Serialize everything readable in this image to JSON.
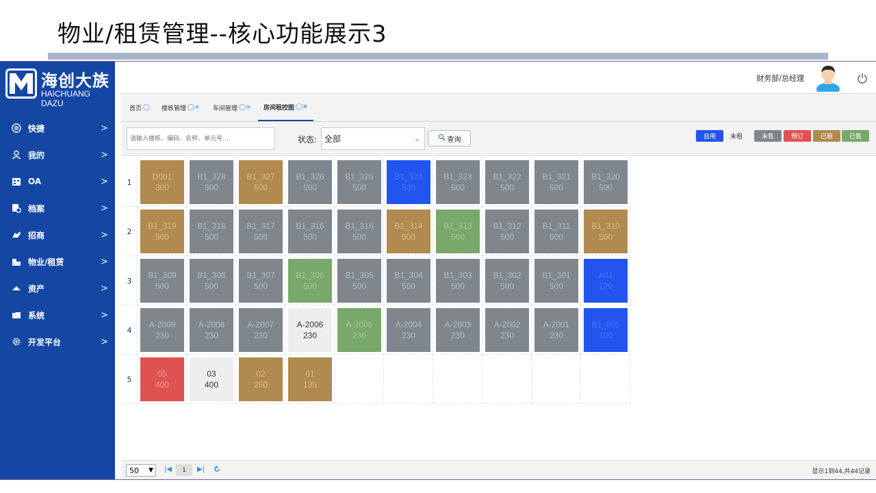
{
  "slide": {
    "title": "物业/租赁管理--核心功能展示3"
  },
  "brand": {
    "name": "海创大族",
    "subtitle": "HAICHUANG DAZU"
  },
  "sidebar": {
    "items": [
      {
        "label": "快捷",
        "icon": "list-circle-icon"
      },
      {
        "label": "我的",
        "icon": "user-icon"
      },
      {
        "label": "OA",
        "icon": "calendar-icon"
      },
      {
        "label": "档案",
        "icon": "archive-icon"
      },
      {
        "label": "招商",
        "icon": "handshake-icon"
      },
      {
        "label": "物业/租赁",
        "icon": "building-icon"
      },
      {
        "label": "资产",
        "icon": "cloud-icon"
      },
      {
        "label": "系统",
        "icon": "folder-icon"
      },
      {
        "label": "开发平台",
        "icon": "gear-icon"
      }
    ]
  },
  "header": {
    "user_role": "财务部/总经理"
  },
  "tabs": [
    {
      "label": "首页",
      "closable": false,
      "active": false
    },
    {
      "label": "楼栋管理",
      "closable": true,
      "active": false
    },
    {
      "label": "车间管理",
      "closable": true,
      "active": false
    },
    {
      "label": "房间租控图",
      "closable": true,
      "active": true
    }
  ],
  "toolbar": {
    "search_placeholder": "请输入楼栋、编码、名称、单元号....",
    "status_label": "状态:",
    "status_value": "全部",
    "query_label": "查询"
  },
  "legend": [
    {
      "label": "自用",
      "bg": "#2255ee",
      "fg": "#ffffff"
    },
    {
      "label": "未租",
      "bg": "#f3f3f3",
      "fg": "#333333"
    },
    {
      "label": "未售",
      "bg": "#7f868c",
      "fg": "#ffffff"
    },
    {
      "label": "预订",
      "bg": "#e05252",
      "fg": "#ffffff"
    },
    {
      "label": "已租",
      "bg": "#b08a4e",
      "fg": "#ffffff"
    },
    {
      "label": "已售",
      "bg": "#78a86a",
      "fg": "#ffffff"
    }
  ],
  "colors": {
    "自用": "#2255ee",
    "未租": "#eeeeee",
    "未售": "#7f868c",
    "预订": "#e05252",
    "已租": "#b08a4e",
    "已售": "#78a86a"
  },
  "rows": [
    {
      "num": "1",
      "rooms": [
        {
          "code": "D001",
          "area": "300",
          "status": "已租"
        },
        {
          "code": "B1_328",
          "area": "500",
          "status": "未售"
        },
        {
          "code": "B1_327",
          "area": "500",
          "status": "已租"
        },
        {
          "code": "B1_326",
          "area": "500",
          "status": "未售"
        },
        {
          "code": "B1_325",
          "area": "500",
          "status": "未售"
        },
        {
          "code": "B1_324",
          "area": "500",
          "status": "自用"
        },
        {
          "code": "B1_323",
          "area": "500",
          "status": "未售"
        },
        {
          "code": "B1_322",
          "area": "500",
          "status": "未售"
        },
        {
          "code": "B1_321",
          "area": "500",
          "status": "未售"
        },
        {
          "code": "B1_320",
          "area": "500",
          "status": "未售"
        }
      ]
    },
    {
      "num": "2",
      "rooms": [
        {
          "code": "B1_319",
          "area": "500",
          "status": "已租"
        },
        {
          "code": "B1_318",
          "area": "500",
          "status": "未售"
        },
        {
          "code": "B1_317",
          "area": "500",
          "status": "未售"
        },
        {
          "code": "B1_316",
          "area": "500",
          "status": "未售"
        },
        {
          "code": "B1_315",
          "area": "500",
          "status": "未售"
        },
        {
          "code": "B1_314",
          "area": "500",
          "status": "已租"
        },
        {
          "code": "B1_313",
          "area": "500",
          "status": "已售"
        },
        {
          "code": "B1_312",
          "area": "500",
          "status": "未售"
        },
        {
          "code": "B1_311",
          "area": "500",
          "status": "未售"
        },
        {
          "code": "B1_310",
          "area": "500",
          "status": "已租"
        }
      ]
    },
    {
      "num": "3",
      "rooms": [
        {
          "code": "B1_309",
          "area": "500",
          "status": "未售"
        },
        {
          "code": "B1_308",
          "area": "500",
          "status": "未售"
        },
        {
          "code": "B1_307",
          "area": "500",
          "status": "未售"
        },
        {
          "code": "B1_306",
          "area": "500",
          "status": "已售"
        },
        {
          "code": "B1_305",
          "area": "500",
          "status": "未售"
        },
        {
          "code": "B1_304",
          "area": "500",
          "status": "未售"
        },
        {
          "code": "B1_303",
          "area": "500",
          "status": "未售"
        },
        {
          "code": "B1_302",
          "area": "500",
          "status": "未售"
        },
        {
          "code": "B1_301",
          "area": "500",
          "status": "未售"
        },
        {
          "code": "A01",
          "area": "120",
          "status": "自用"
        }
      ]
    },
    {
      "num": "4",
      "rooms": [
        {
          "code": "A-2009",
          "area": "230",
          "status": "未售"
        },
        {
          "code": "A-2008",
          "area": "230",
          "status": "未售"
        },
        {
          "code": "A-2007",
          "area": "230",
          "status": "未售"
        },
        {
          "code": "A-2006",
          "area": "230",
          "status": "未租"
        },
        {
          "code": "A-2005",
          "area": "230",
          "status": "已售"
        },
        {
          "code": "A-2004",
          "area": "230",
          "status": "未售"
        },
        {
          "code": "A-2003",
          "area": "230",
          "status": "未售"
        },
        {
          "code": "A-2002",
          "area": "230",
          "status": "未售"
        },
        {
          "code": "A-2001",
          "area": "230",
          "status": "未售"
        },
        {
          "code": "B1_001",
          "area": "100",
          "status": "自用"
        }
      ]
    },
    {
      "num": "5",
      "rooms": [
        {
          "code": "05",
          "area": "400",
          "status": "预订"
        },
        {
          "code": "03",
          "area": "400",
          "status": "未租"
        },
        {
          "code": "02",
          "area": "250",
          "status": "已租"
        },
        {
          "code": "01",
          "area": "135",
          "status": "已租"
        }
      ]
    }
  ],
  "footer": {
    "page_size": "50",
    "current_page": "1",
    "record_info": "显示1到44,共44记录"
  }
}
